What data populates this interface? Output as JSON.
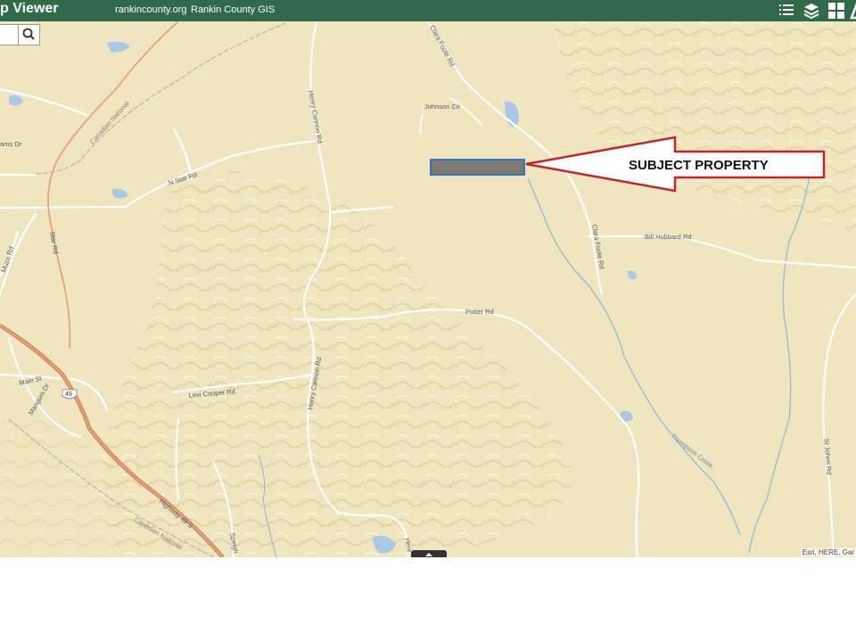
{
  "header": {
    "title": "p Viewer",
    "links": [
      "rankincounty.org",
      "Rankin County GIS"
    ],
    "tools": [
      "list-icon",
      "layers-icon",
      "grid-icon"
    ]
  },
  "map": {
    "road_labels": {
      "clara_foote_north": "Clara Foote Rd",
      "johnson": "Johnson Cir",
      "henry_cannon_north": "Henry Cannon Rd",
      "adams": "ams Dr",
      "canadian_national_north": "Canadian National",
      "n_star": "N Star Rd",
      "star": "Star Rd",
      "muze": "Muze Rd",
      "bill_hubbard": "Bill Hubbard Rd",
      "clara_foote_south": "Clara Foote Rd",
      "potter": "Potter Rd",
      "main": "Main St",
      "route_49": "49",
      "mangum": "Mangum Dr",
      "levi_cooper": "Levi Cooper Rd",
      "henry_cannon_south": "Henry Cannon Rd",
      "thompson_creek": "Thompson Creek",
      "st_johns": "St Johns Rd",
      "highway_49": "Highway 49 S",
      "canadian_national_south": "Canadian National",
      "speight": "Speigh",
      "henry_edge": "Henr"
    },
    "callout": "SUBJECT PROPERTY",
    "attribution": "Esri, HERE, Gar",
    "colors": {
      "background": "#efe6bf",
      "road": "#ffffff",
      "highway": "#d98a5a",
      "water": "#a9c8e6",
      "parcel_fill": "#7d7a70",
      "parcel_outline": "#1f6fd6",
      "arrow": "#c0272d",
      "header": "#2f6b4a"
    }
  }
}
